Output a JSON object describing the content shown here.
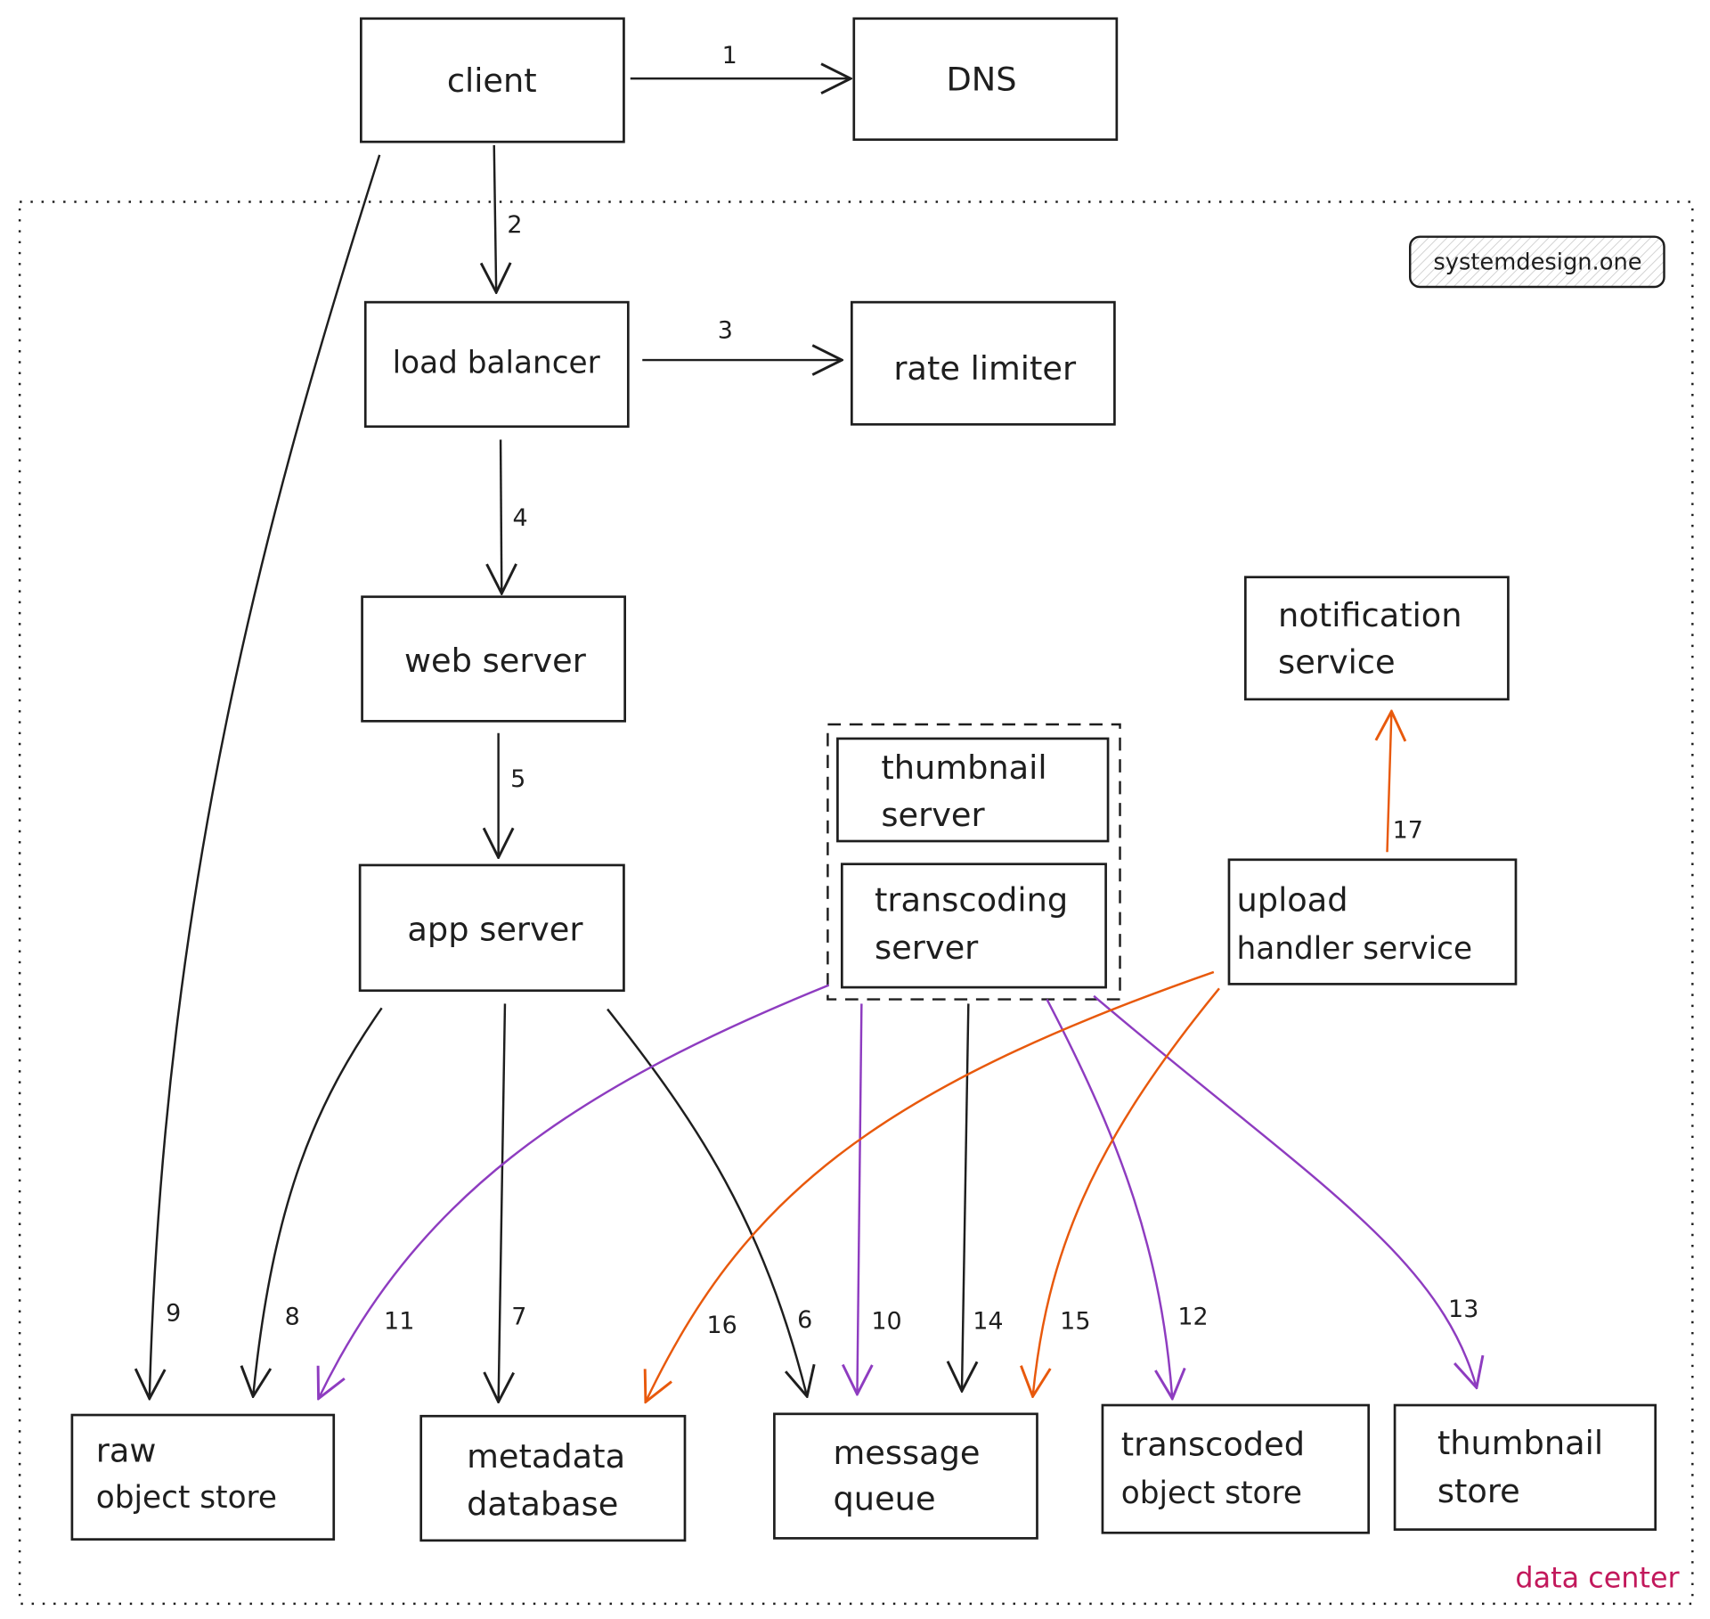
{
  "colors": {
    "stroke": "#1e1e1e",
    "purple_arrows": "#8e3cc0",
    "orange_arrows": "#e8590c",
    "data_center_label": "#c2185b"
  },
  "badge": "systemdesign.one",
  "region_label": "data center",
  "nodes": {
    "client": [
      "client"
    ],
    "dns": [
      "DNS"
    ],
    "load_balancer": [
      "load balancer"
    ],
    "rate_limiter": [
      "rate limiter"
    ],
    "web_server": [
      "web server"
    ],
    "app_server": [
      "app server"
    ],
    "thumbnail_server": [
      "thumbnail",
      "server"
    ],
    "transcoding_server": [
      "transcoding",
      "server"
    ],
    "notification_service": [
      "notification",
      "service"
    ],
    "upload_handler_service": [
      "upload",
      "handler service"
    ],
    "raw_object_store": [
      "raw",
      "object store"
    ],
    "metadata_database": [
      "metadata",
      "database"
    ],
    "message_queue": [
      "message",
      "queue"
    ],
    "transcoded_object_store": [
      "transcoded",
      "object store"
    ],
    "thumbnail_store": [
      "thumbnail",
      "store"
    ]
  },
  "edges": [
    {
      "label": "1",
      "from": "client",
      "to": "DNS",
      "color": "black"
    },
    {
      "label": "2",
      "from": "client",
      "to": "load balancer",
      "color": "black"
    },
    {
      "label": "3",
      "from": "load balancer",
      "to": "rate limiter",
      "color": "black"
    },
    {
      "label": "4",
      "from": "load balancer",
      "to": "web server",
      "color": "black"
    },
    {
      "label": "5",
      "from": "web server",
      "to": "app server",
      "color": "black"
    },
    {
      "label": "6",
      "from": "app server",
      "to": "message queue",
      "color": "black"
    },
    {
      "label": "7",
      "from": "app server",
      "to": "metadata database",
      "color": "black"
    },
    {
      "label": "8",
      "from": "app server",
      "to": "raw object store",
      "color": "black"
    },
    {
      "label": "9",
      "from": "client",
      "to": "raw object store",
      "color": "black"
    },
    {
      "label": "10",
      "from": "message queue",
      "to": "transcoding server",
      "color": "purple"
    },
    {
      "label": "11",
      "from": "transcoding server",
      "to": "raw object store",
      "color": "purple"
    },
    {
      "label": "12",
      "from": "transcoding server",
      "to": "transcoded object store",
      "color": "purple"
    },
    {
      "label": "13",
      "from": "transcoding server",
      "to": "thumbnail store",
      "color": "purple"
    },
    {
      "label": "14",
      "from": "transcoding server",
      "to": "message queue",
      "color": "black"
    },
    {
      "label": "15",
      "from": "upload handler service",
      "to": "message queue",
      "color": "orange"
    },
    {
      "label": "16",
      "from": "upload handler service",
      "to": "metadata database",
      "color": "orange"
    },
    {
      "label": "17",
      "from": "upload handler service",
      "to": "notification service",
      "color": "orange"
    }
  ]
}
